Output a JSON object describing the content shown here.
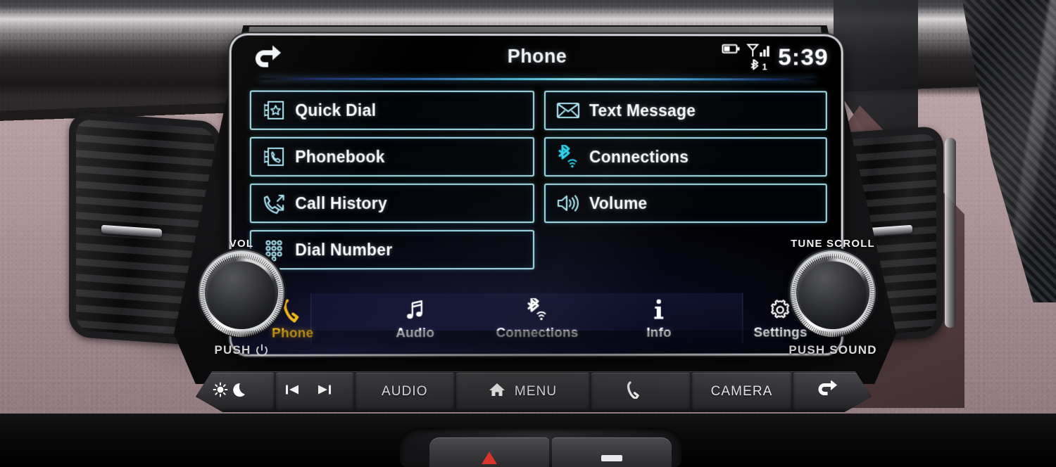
{
  "screen": {
    "title": "Phone",
    "back_icon": "back-arrow-icon",
    "status": {
      "battery_icon": "battery-icon",
      "signal_icon": "signal-strength-icon",
      "bluetooth_icon": "bluetooth-icon",
      "bluetooth_count": "1",
      "clock": "5:39"
    },
    "menu_left": [
      {
        "label": "Quick Dial",
        "icon": "quick-dial-icon"
      },
      {
        "label": "Phonebook",
        "icon": "phonebook-icon"
      },
      {
        "label": "Call History",
        "icon": "call-history-icon"
      },
      {
        "label": "Dial Number",
        "icon": "dial-pad-icon"
      }
    ],
    "menu_right": [
      {
        "label": "Text Message",
        "icon": "envelope-icon"
      },
      {
        "label": "Connections",
        "icon": "bluetooth-wifi-icon"
      },
      {
        "label": "Volume",
        "icon": "speaker-icon"
      }
    ],
    "nav": [
      {
        "label": "Phone",
        "icon": "phone-handset-icon",
        "active": true
      },
      {
        "label": "Audio",
        "icon": "music-note-icon",
        "active": false
      },
      {
        "label": "Connections",
        "icon": "bluetooth-wifi-icon",
        "active": false
      },
      {
        "label": "Info",
        "icon": "info-icon",
        "active": false
      },
      {
        "label": "Settings",
        "icon": "gear-icon",
        "active": false
      }
    ],
    "accent_active": "#f3b91d",
    "accent_tile_border": "#a9e6f2"
  },
  "knobs": {
    "left": {
      "top_label": "VOL",
      "bottom_label": "PUSH",
      "bottom_icon": "power-icon"
    },
    "right": {
      "top_label": "TUNE SCROLL",
      "bottom_label": "PUSH SOUND",
      "bottom_icon": ""
    }
  },
  "hard_buttons": [
    {
      "label": "",
      "icon": "day-night-icon",
      "name": "display-mode-button"
    },
    {
      "label": "",
      "icon": "track-skip-icon",
      "name": "track-skip-button"
    },
    {
      "label": "AUDIO",
      "icon": "",
      "name": "audio-button"
    },
    {
      "label": "MENU",
      "icon": "home-icon",
      "name": "menu-button"
    },
    {
      "label": "",
      "icon": "phone-handset-icon",
      "name": "phone-button"
    },
    {
      "label": "CAMERA",
      "icon": "",
      "name": "camera-button"
    },
    {
      "label": "",
      "icon": "back-arrow-icon",
      "name": "back-button"
    }
  ],
  "console": {
    "hazard_icon": "hazard-triangle-icon",
    "aux_icon": "aux-button-icon"
  }
}
